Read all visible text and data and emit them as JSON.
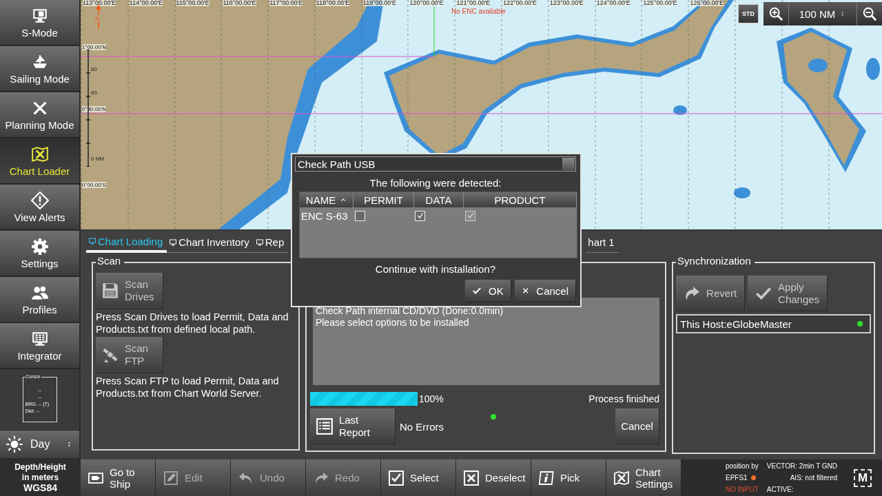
{
  "sidebar": {
    "items": [
      {
        "label": "S-Mode",
        "selected": false
      },
      {
        "label": "Sailing Mode",
        "selected": false
      },
      {
        "label": "Planning Mode",
        "selected": false
      },
      {
        "label": "Chart Loader",
        "selected": true
      },
      {
        "label": "View Alerts",
        "selected": false
      },
      {
        "label": "Settings",
        "selected": false
      },
      {
        "label": "Profiles",
        "selected": false
      },
      {
        "label": "Integrator",
        "selected": false
      }
    ]
  },
  "cursor_box": {
    "title": "Cursor",
    "lines": [
      "--",
      "--",
      "BRG: -- (T)",
      "Dist: --"
    ]
  },
  "day_mode": {
    "value": "Day"
  },
  "depth_info": {
    "lines": [
      "Depth/Height",
      "in meters"
    ],
    "datum": "WGS84"
  },
  "chart": {
    "north_label": "N",
    "longitude_labels": [
      "113°00.00'E",
      "114°00.00'E",
      "115°00.00'E",
      "116°00.00'E",
      "117°00.00'E",
      "118°00.00'E",
      "119°00.00'E",
      "120°00.00'E",
      "121°00.00'E",
      "122°00.00'E",
      "123°00.00'E",
      "124°00.00'E",
      "125°00.00'E",
      "126°00.00'E"
    ],
    "latitude_labels": [
      "1°00.00'N",
      "0°30.00'N",
      "0°00.00'S"
    ],
    "scale_labels": [
      "80",
      "60",
      "0 NM"
    ],
    "notice": "No ENC available",
    "std_button": "STD",
    "range": "100 NM"
  },
  "tabs": [
    {
      "label": "Chart Loading",
      "selected": true
    },
    {
      "label": "Chart Inventory",
      "selected": false
    },
    {
      "label": "Rep",
      "selected": false
    },
    {
      "label": "hart 1",
      "selected": false
    }
  ],
  "scan": {
    "title": "Scan",
    "items": [
      {
        "button": "Scan Drives",
        "disabled": true,
        "hint": "Press Scan Drives to load Permit, Data and Products.txt from defined local path."
      },
      {
        "button": "Scan FTP",
        "disabled": true,
        "hint": "Press Scan FTP to load Permit, Data and Products.txt from Chart World Server."
      }
    ]
  },
  "process": {
    "log": [
      "Check Path internal CD/DVD (Done:0.0min)",
      "Please select options to be installed"
    ],
    "progress": {
      "level": 1,
      "reading": "100%"
    },
    "status": "Process finished",
    "report_button": "Last Report",
    "result": "No Errors",
    "ok": true,
    "cancel_button": "Cancel"
  },
  "synchronization": {
    "title": "Synchronization",
    "buttons": [
      {
        "label": "Revert",
        "disabled": true
      },
      {
        "label": "Apply Changes",
        "disabled": true
      }
    ],
    "hosts": [
      {
        "name": "This Host:eGlobeMaster",
        "online": true
      }
    ]
  },
  "toolbar": [
    {
      "label": "Go to Ship",
      "disabled": false
    },
    {
      "label": "Edit",
      "disabled": true
    },
    {
      "label": "Undo",
      "disabled": true
    },
    {
      "label": "Redo",
      "disabled": true
    },
    {
      "label": "Select",
      "disabled": false
    },
    {
      "label": "Deselect",
      "disabled": false
    },
    {
      "label": "Pick",
      "disabled": false
    },
    {
      "label": "Chart Settings",
      "disabled": false
    }
  ],
  "status": {
    "position_label": "position by",
    "position_source": "EPFS1",
    "source_ok": false,
    "input": "NO INPUT",
    "vector": "VECTOR: 2min T GND",
    "ais": "AIS: not filtered",
    "active": "ACTIVE:",
    "mode_badge": "M"
  },
  "dialog": {
    "title": "Check Path USB",
    "message": "The following were detected:",
    "columns": [
      {
        "label": "NAME",
        "sorted": true
      },
      {
        "label": "PERMIT",
        "sorted": false
      },
      {
        "label": "DATA",
        "sorted": false
      },
      {
        "label": "PRODUCT",
        "sorted": false
      }
    ],
    "rows": [
      {
        "name": "ENC S-63",
        "permit": false,
        "data": true,
        "product": true,
        "product_disabled": true
      }
    ],
    "question": "Continue with installation?",
    "buttons": [
      "OK",
      "Cancel"
    ]
  }
}
